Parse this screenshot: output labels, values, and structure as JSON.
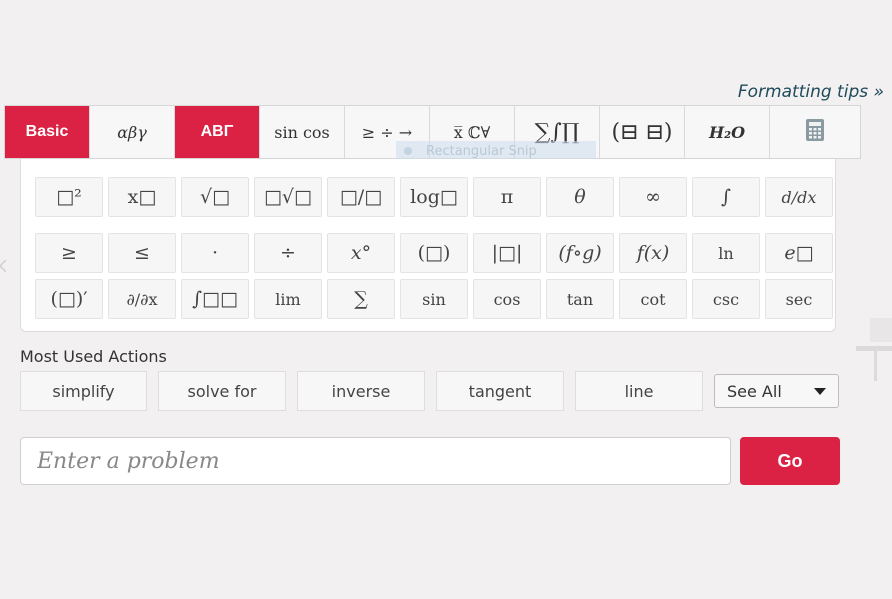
{
  "formatting_tips": "Formatting tips »",
  "tabs": [
    {
      "label": "Basic",
      "active": true
    },
    {
      "label": "αβγ",
      "active": false
    },
    {
      "label": "ΑΒΓ",
      "active": true
    },
    {
      "label": "sin cos",
      "active": false
    },
    {
      "label": "≥ ÷ →",
      "active": false
    },
    {
      "label": "x̅ ℂ∀",
      "active": false
    },
    {
      "label": "∑∫∏",
      "active": false
    },
    {
      "label": "(⊟ ⊟)",
      "active": false
    },
    {
      "label": "H₂O",
      "active": false
    },
    {
      "label": "calculator-icon",
      "active": false
    }
  ],
  "snip_overlay": "Rectangular Snip",
  "keypad": {
    "row1": [
      "□²",
      "x□",
      "√□",
      "□√□",
      "□/□",
      "log□",
      "π",
      "θ",
      "∞",
      "∫",
      "d/dx"
    ],
    "row2": [
      "≥",
      "≤",
      "·",
      "÷",
      "x°",
      "(□)",
      "|□|",
      "(f∘g)",
      "f(x)",
      "ln",
      "e□"
    ],
    "row3": [
      "(□)′",
      "∂/∂x",
      "∫□□",
      "lim",
      "∑",
      "sin",
      "cos",
      "tan",
      "cot",
      "csc",
      "sec"
    ]
  },
  "most_used": {
    "label": "Most Used Actions",
    "actions": [
      "simplify",
      "solve for",
      "inverse",
      "tangent",
      "line"
    ],
    "see_all": "See All"
  },
  "problem_input": {
    "placeholder": "Enter a problem",
    "value": ""
  },
  "go_label": "Go",
  "colors": {
    "accent": "#dc2244",
    "background": "#f2f0f1",
    "link": "#1f4a5a"
  }
}
